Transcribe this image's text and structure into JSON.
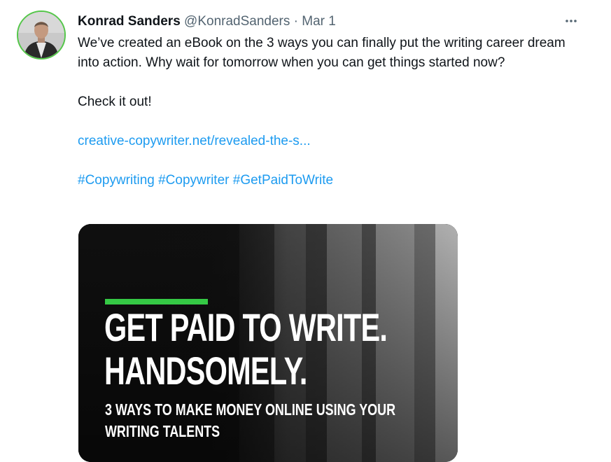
{
  "tweet": {
    "author_name": "Konrad Sanders",
    "author_handle": "@KonradSanders",
    "separator": "·",
    "date": "Mar 1",
    "more_icon": "more-horizontal-icon",
    "body_line1": "We’ve created an eBook on the 3 ways you can finally put the writing career dream into action. Why wait for tomorrow when you can get things started now?",
    "body_line2": "Check it out!",
    "link": "creative-copywriter.net/revealed-the-s...",
    "hashtags": [
      "#Copywriting",
      "#Copywriter",
      "#GetPaidToWrite"
    ]
  },
  "media": {
    "headline_line1": "GET PAID TO WRITE.",
    "headline_line2": "HANDSOMELY.",
    "subline_line1": "3 WAYS TO MAKE MONEY ONLINE USING YOUR",
    "subline_line2": "WRITING TALENTS",
    "accent_color": "#35c945"
  },
  "colors": {
    "text": "#0f1419",
    "muted": "#536471",
    "link": "#1d9bf0",
    "avatar_ring": "#54c749"
  }
}
